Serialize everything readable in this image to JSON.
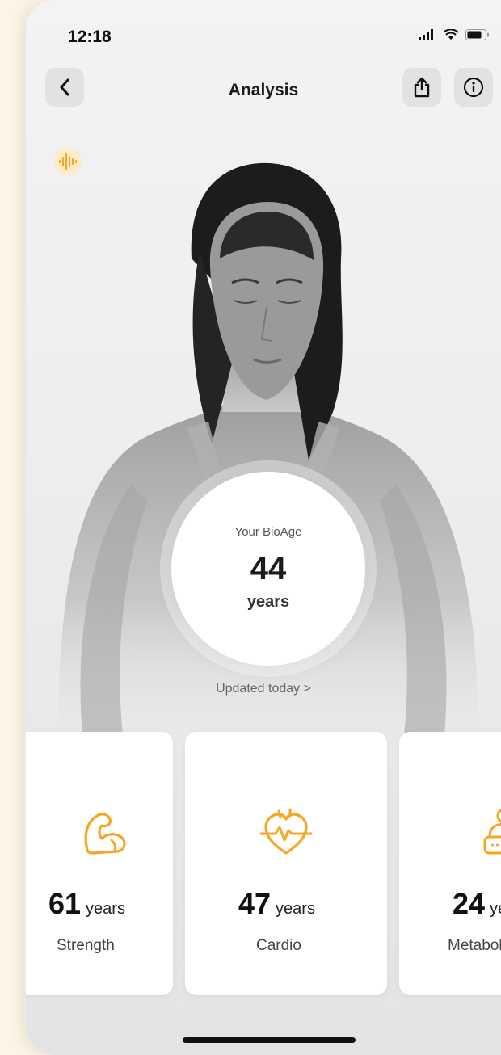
{
  "status_bar": {
    "time": "12:18"
  },
  "nav": {
    "title": "Analysis"
  },
  "bioage": {
    "label": "Your BioAge",
    "value": "44",
    "unit": "years",
    "updated": "Updated today >"
  },
  "cards": [
    {
      "value": "61",
      "unit": "years",
      "label": "Strength",
      "icon": "flexed-arm-icon"
    },
    {
      "value": "47",
      "unit": "years",
      "label": "Cardio",
      "icon": "heart-pulse-icon"
    },
    {
      "value": "24",
      "unit": "years",
      "label": "Metabolism",
      "icon": "body-scale-icon"
    }
  ],
  "colors": {
    "accent": "#f6a623",
    "background": "#eeeeef"
  }
}
